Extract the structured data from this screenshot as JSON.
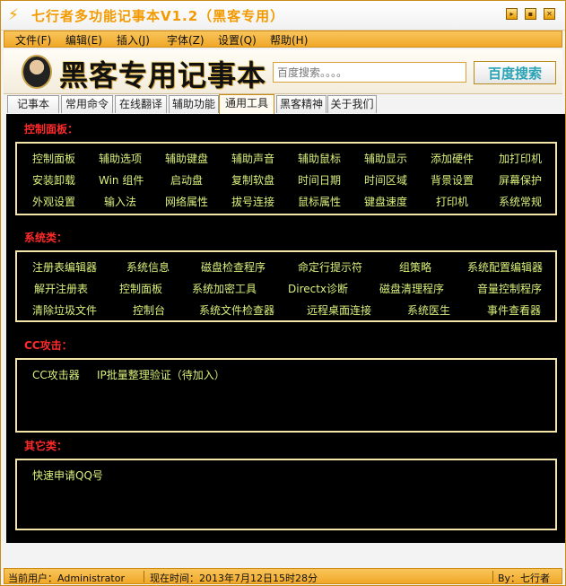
{
  "window": {
    "title": "七行者多功能记事本V1.2（黑客专用）",
    "controls": [
      "minimize",
      "restore",
      "close"
    ]
  },
  "menu": [
    "文件(F)",
    "编辑(E)",
    "插入(J)",
    "字体(Z)",
    "设置(Q)",
    "帮助(H)"
  ],
  "banner": {
    "logo_text": "黑客专用记事本",
    "search_placeholder": "百度搜索。。。。",
    "search_button": "百度搜索"
  },
  "tabs": [
    "记事本",
    "常用命令",
    "在线翻译",
    "辅助功能",
    "通用工具",
    "黑客精神",
    "关于我们"
  ],
  "active_tab": "通用工具",
  "sections": [
    {
      "title": "控制面板：",
      "rows": [
        [
          "控制面板",
          "辅助选项",
          "辅助键盘",
          "辅助声音",
          "辅助鼠标",
          "辅助显示",
          "添加硬件",
          "加打印机"
        ],
        [
          "安装卸载",
          "Win 组件",
          "启动盘",
          "复制软盘",
          "时间日期",
          "时间区域",
          "背景设置",
          "屏幕保护"
        ],
        [
          "外观设置",
          "输入法",
          "网络属性",
          "拔号连接",
          "鼠标属性",
          "键盘速度",
          "打印机",
          "系统常规"
        ]
      ]
    },
    {
      "title": "系统类：",
      "rows": [
        [
          "注册表编辑器",
          "系统信息",
          "磁盘检查程序",
          "命定行提示符",
          "组策略",
          "系统配置编辑器"
        ],
        [
          "解开注册表",
          "控制面板",
          "系统加密工具",
          "Directx诊断",
          "磁盘清理程序",
          "音量控制程序"
        ],
        [
          "清除垃圾文件",
          "控制台",
          "系统文件检查器",
          "远程桌面连接",
          "系统医生",
          "事件查看器"
        ]
      ]
    },
    {
      "title": "CC攻击：",
      "rows": [
        [
          "CC攻击器",
          "IP批量整理验证（待加入）"
        ]
      ]
    },
    {
      "title": "其它类：",
      "rows": [
        [
          "快速申请QQ号"
        ]
      ]
    }
  ],
  "status": {
    "user": "当前用户：Administrator",
    "time": "现在时间：2013年7月12日15时28分",
    "author": "By：七行者"
  },
  "colors": {
    "accent": "#f0a828",
    "panel_bg": "#000000",
    "section_title": "#ff2a2a",
    "item_text": "#d9f07a",
    "box_border": "#f3e6a8"
  }
}
